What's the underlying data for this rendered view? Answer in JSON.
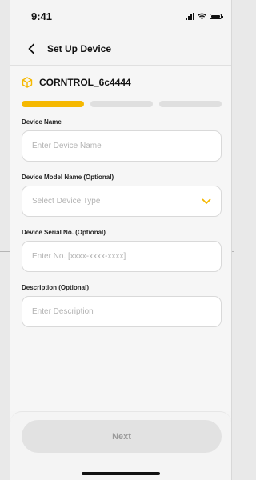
{
  "status_bar": {
    "time": "9:41"
  },
  "header": {
    "title": "Set Up Device",
    "back_icon": "chevron-left-icon"
  },
  "device": {
    "icon": "package-icon",
    "name": "CORNTROL_6c4444",
    "accent_color": "#f5b800"
  },
  "progress": {
    "total_steps": 3,
    "current_step": 1
  },
  "form": {
    "device_name": {
      "label": "Device Name",
      "placeholder": "Enter Device Name",
      "value": ""
    },
    "device_model": {
      "label": "Device Model Name (Optional)",
      "placeholder": "Select Device Type",
      "icon": "chevron-down-icon"
    },
    "serial": {
      "label": "Device Serial No. (Optional)",
      "placeholder": "Enter No. [xxxx-xxxx-xxxx]",
      "value": ""
    },
    "description": {
      "label": "Description (Optional)",
      "placeholder": "Enter Description",
      "value": ""
    }
  },
  "footer": {
    "next_label": "Next",
    "next_enabled": false
  }
}
